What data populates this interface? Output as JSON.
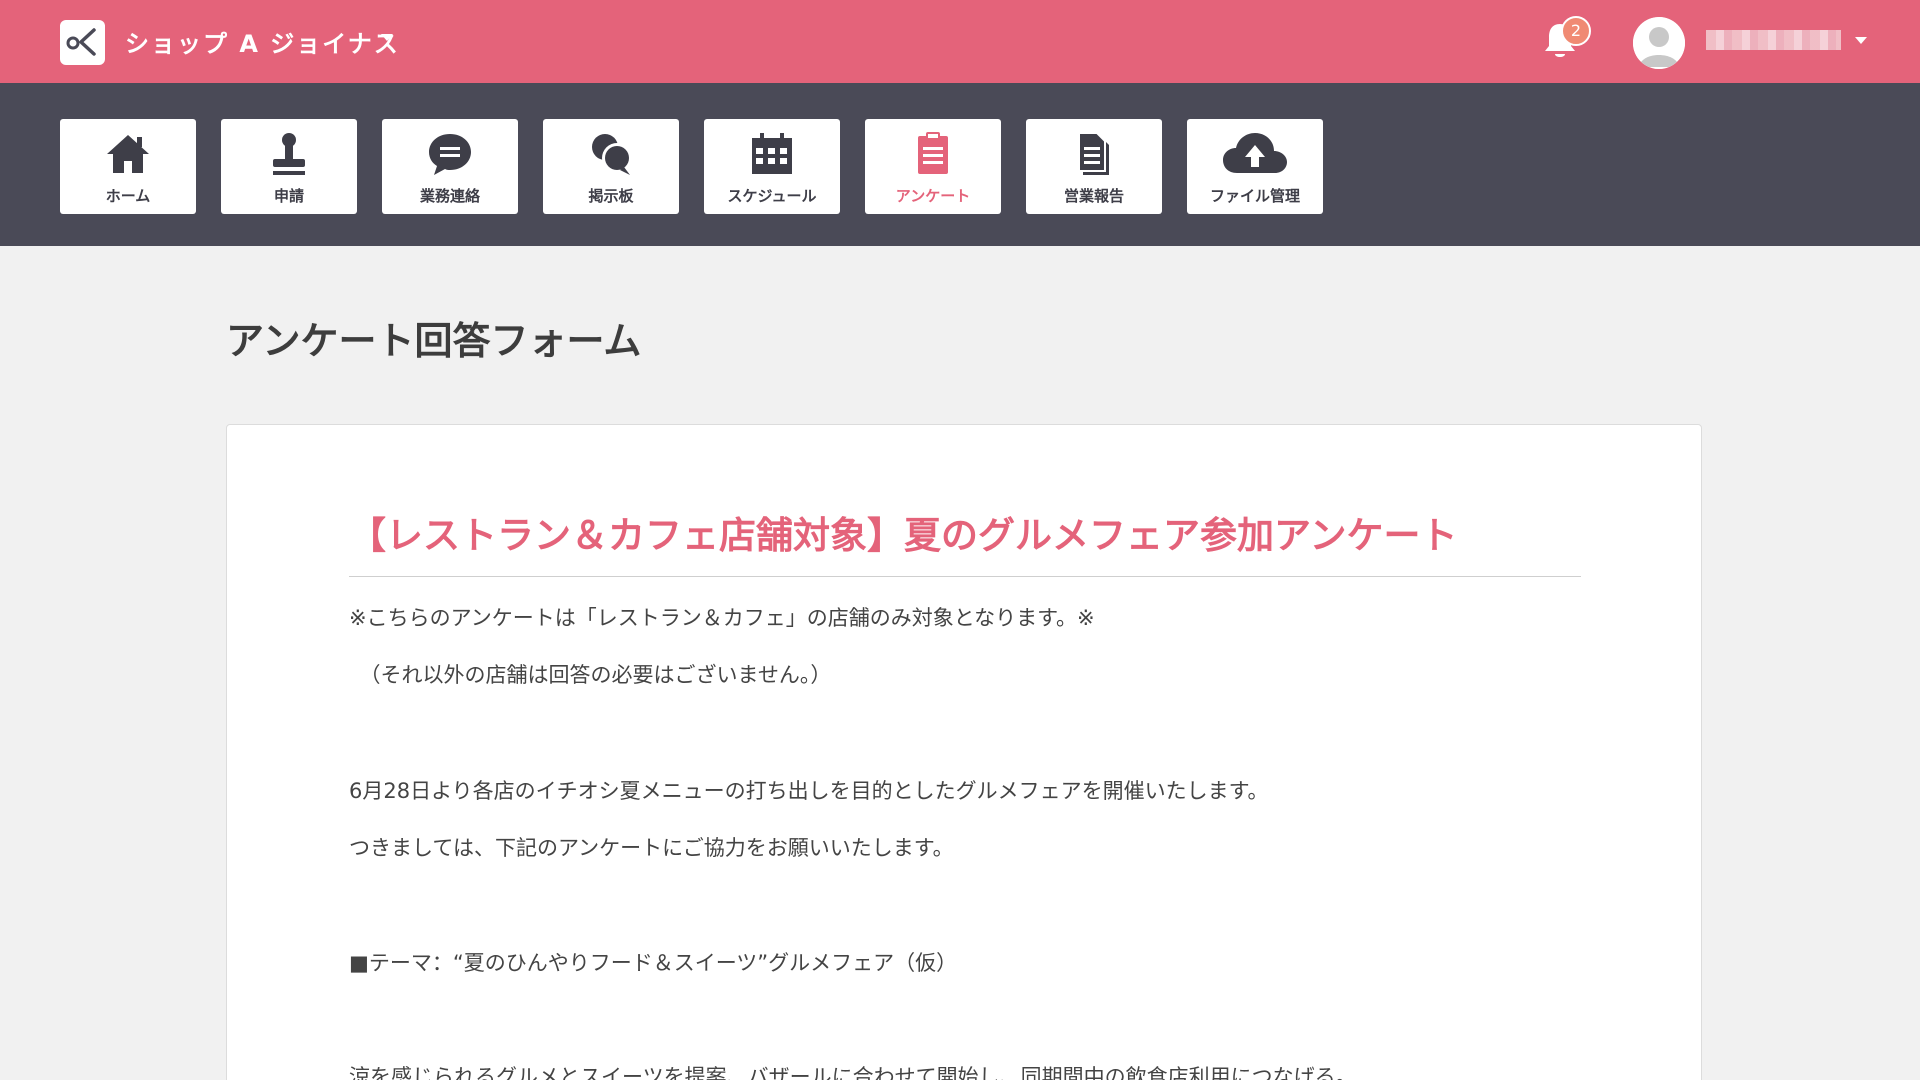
{
  "app": {
    "shop_name": "ショップ A ジョイナス",
    "notification_count": "2",
    "brand_color": "#e4637a",
    "navbar_color": "#4a4a57"
  },
  "nav": {
    "items": [
      {
        "label": "ホーム",
        "icon": "home-icon",
        "active": false
      },
      {
        "label": "申請",
        "icon": "stamp-icon",
        "active": false
      },
      {
        "label": "業務連絡",
        "icon": "chat-bubble-icon",
        "active": false
      },
      {
        "label": "掲示板",
        "icon": "bulletin-board-icon",
        "active": false
      },
      {
        "label": "スケジュール",
        "icon": "calendar-icon",
        "active": false
      },
      {
        "label": "アンケート",
        "icon": "clipboard-icon",
        "active": true
      },
      {
        "label": "営業報告",
        "icon": "document-icon",
        "active": false
      },
      {
        "label": "ファイル管理",
        "icon": "cloud-upload-icon",
        "active": false
      }
    ]
  },
  "page": {
    "title": "アンケート回答フォーム"
  },
  "survey": {
    "title": "【レストラン＆カフェ店舗対象】夏のグルメフェア参加アンケート",
    "lines": [
      "※こちらのアンケートは「レストラン＆カフェ」の店舗のみ対象となります。※",
      "　（それ以外の店舗は回答の必要はございません。）",
      "6月28日より各店のイチオシ夏メニューの打ち出しを目的としたグルメフェアを開催いたします。",
      "つきましては、下記のアンケートにご協力をお願いいたします。",
      "■テーマ：“夏のひんやりフード＆スイーツ”グルメフェア（仮）",
      "涼を感じられるグルメとスイーツを提案、バザールに合わせて開始し、同期間中の飲食店利用につなげる。"
    ]
  }
}
